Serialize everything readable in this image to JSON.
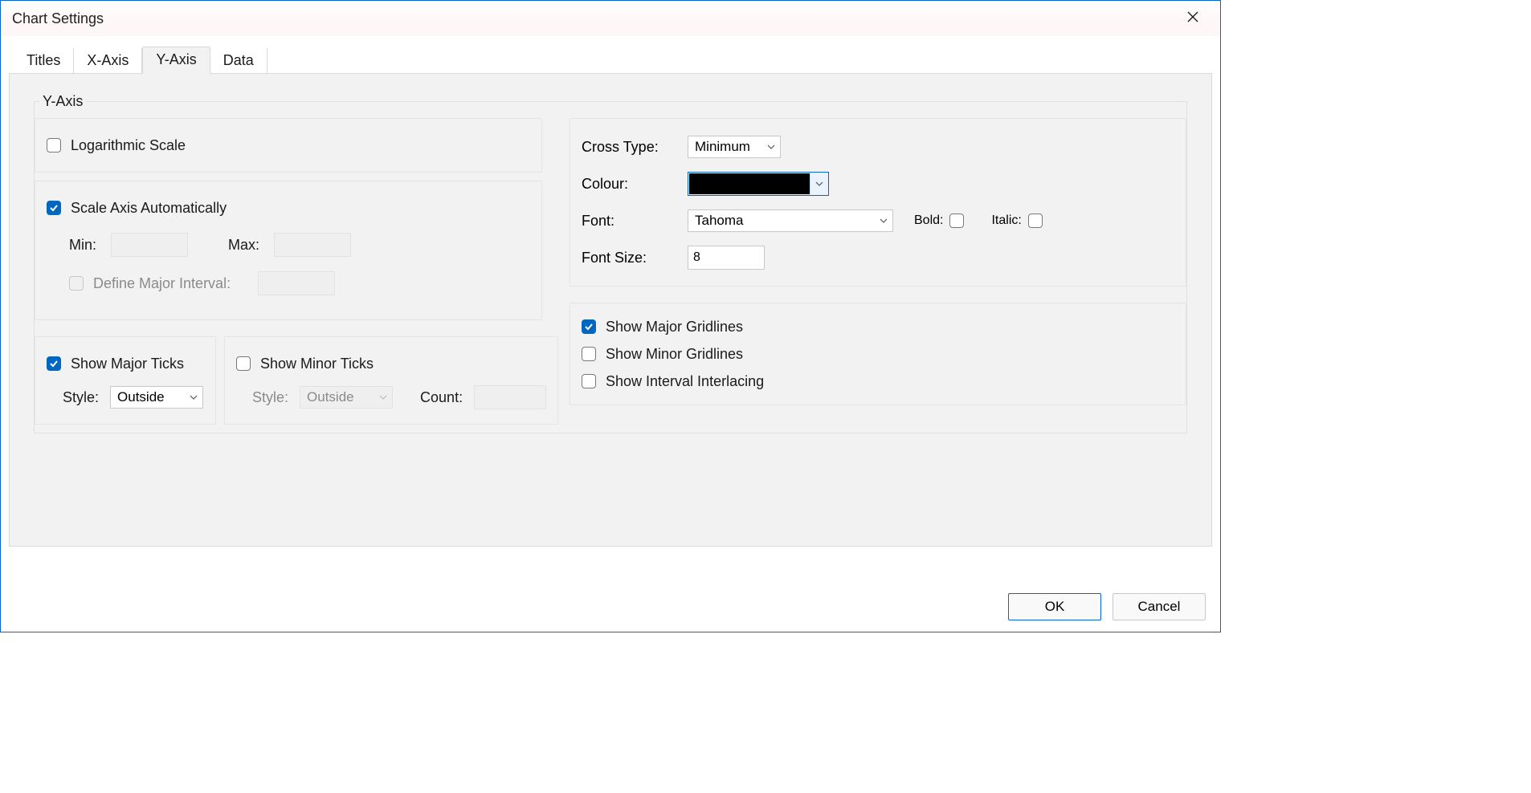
{
  "window": {
    "title": "Chart Settings"
  },
  "tabs": {
    "titles": "Titles",
    "xaxis": "X-Axis",
    "yaxis": "Y-Axis",
    "data": "Data",
    "active": "yaxis"
  },
  "group": {
    "legend": "Y-Axis"
  },
  "left": {
    "log_scale": {
      "label": "Logarithmic Scale",
      "checked": false
    },
    "scale_auto": {
      "label": "Scale Axis Automatically",
      "checked": true
    },
    "min_label": "Min:",
    "min_value": "",
    "max_label": "Max:",
    "max_value": "",
    "define_interval": {
      "label": "Define Major Interval:",
      "checked": false,
      "value": ""
    },
    "major_ticks": {
      "show_label": "Show Major Ticks",
      "show_checked": true,
      "style_label": "Style:",
      "style_value": "Outside"
    },
    "minor_ticks": {
      "show_label": "Show Minor Ticks",
      "show_checked": false,
      "style_label": "Style:",
      "style_value": "Outside",
      "count_label": "Count:",
      "count_value": ""
    }
  },
  "right": {
    "cross_type": {
      "label": "Cross Type:",
      "value": "Minimum"
    },
    "colour": {
      "label": "Colour:",
      "value": "#000000"
    },
    "font": {
      "label": "Font:",
      "value": "Tahoma"
    },
    "bold": {
      "label": "Bold:",
      "checked": false
    },
    "italic": {
      "label": "Italic:",
      "checked": false
    },
    "font_size": {
      "label": "Font Size:",
      "value": "8"
    },
    "gridlines": {
      "major": {
        "label": "Show Major Gridlines",
        "checked": true
      },
      "minor": {
        "label": "Show Minor Gridlines",
        "checked": false
      },
      "interlace": {
        "label": "Show Interval Interlacing",
        "checked": false
      }
    }
  },
  "buttons": {
    "ok": "OK",
    "cancel": "Cancel"
  }
}
